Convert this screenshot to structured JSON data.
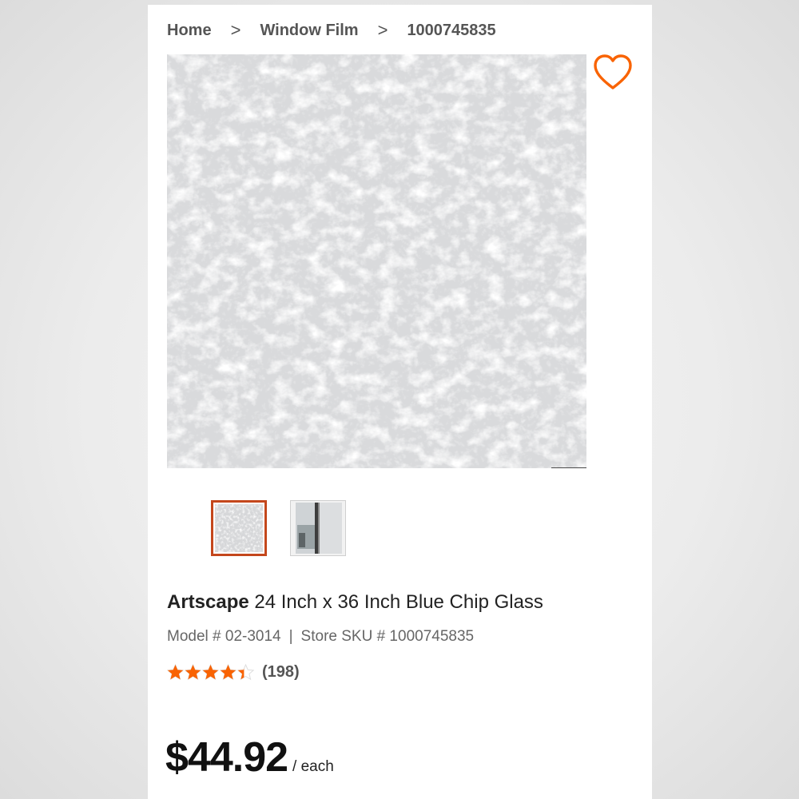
{
  "breadcrumb": {
    "items": [
      "Home",
      "Window Film",
      "1000745835"
    ],
    "separator": ">"
  },
  "wishlist": {
    "icon": "heart-outline-icon",
    "color": "#f96302"
  },
  "gallery": {
    "main_image": "frosted-glass-texture",
    "zoom_icon": "plus-icon",
    "zoom_symbol": "+",
    "thumbnails": [
      {
        "image": "frosted-glass-texture",
        "selected": true
      },
      {
        "image": "window-film-applied",
        "selected": false
      }
    ],
    "selected_border_color": "#c4471c"
  },
  "product": {
    "brand": "Artscape",
    "name": "24 Inch x 36 Inch Blue Chip Glass",
    "model_label": "Model # 02-3014",
    "sku_label": "Store SKU # 1000745835",
    "separator": "|"
  },
  "rating": {
    "value": 4.4,
    "max": 5,
    "count_text": "(198)",
    "star_color": "#f96302"
  },
  "price": {
    "amount": "$44.92",
    "unit": "/ each"
  }
}
